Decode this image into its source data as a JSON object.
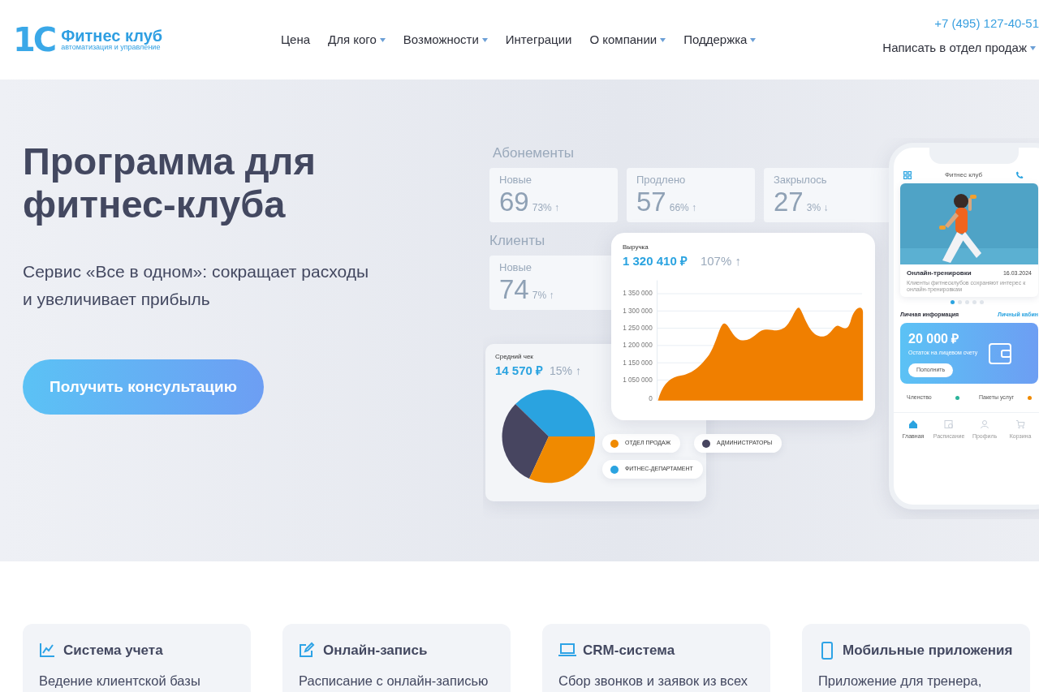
{
  "header": {
    "logo": {
      "mark": "1С",
      "name": "Фитнес клуб",
      "tagline": "автоматизация и управление"
    },
    "nav": [
      {
        "label": "Цена",
        "has_dropdown": false
      },
      {
        "label": "Для кого",
        "has_dropdown": true
      },
      {
        "label": "Возможности",
        "has_dropdown": true
      },
      {
        "label": "Интеграции",
        "has_dropdown": false
      },
      {
        "label": "О компании",
        "has_dropdown": true
      },
      {
        "label": "Поддержка",
        "has_dropdown": true
      }
    ],
    "phone": "+7 (495) 127-40-51",
    "contact": {
      "label": "Написать в отдел продаж",
      "has_dropdown": true
    }
  },
  "hero": {
    "title": "Программа для фитнес-клуба",
    "subtitle": "Сервис «Все в одном»: сокращает расходы и увеличивает прибыль",
    "cta": "Получить консультацию"
  },
  "illustration": {
    "subscriptions": {
      "title": "Абонементы",
      "stats": [
        {
          "label": "Новые",
          "value": "69",
          "change": "73% ↑"
        },
        {
          "label": "Продлено",
          "value": "57",
          "change": "66% ↑"
        },
        {
          "label": "Закрылось",
          "value": "27",
          "change": "3% ↓"
        }
      ]
    },
    "clients": {
      "title": "Клиенты",
      "stats": [
        {
          "label": "Новые",
          "value": "74",
          "change": "7% ↑"
        }
      ]
    },
    "revenue": {
      "title": "Выручка",
      "amount": "1 320 410 ₽",
      "change": "107% ↑",
      "axis_labels": [
        "1 350 000",
        "1 300 000",
        "1 250 000",
        "1 200 000",
        "1 150 000",
        "1 050 000",
        "0"
      ]
    },
    "average_check": {
      "title": "Средний чек",
      "amount": "14 570 ₽",
      "change": "15% ↑",
      "legend": [
        {
          "label": "ОТДЕЛ ПРОДАЖ",
          "color": "#f08a00"
        },
        {
          "label": "АДМИНИСТРАТОРЫ",
          "color": "#474560"
        },
        {
          "label": "ФИТНЕС-ДЕПАРТАМЕНТ",
          "color": "#2aa3e0"
        }
      ]
    },
    "phone": {
      "title": "Фитнес клуб",
      "news": {
        "title": "Онлайн-тренировки",
        "date": "16.03.2024",
        "text": "Клиенты фитнесклубов сохраняют интерес к онлайн-тренировкам"
      },
      "dots": [
        {
          "selected": true
        },
        {
          "selected": false
        },
        {
          "selected": false
        },
        {
          "selected": false
        },
        {
          "selected": false
        }
      ],
      "personal_title": "Личная информация",
      "account_link": "Личный кабин",
      "balance": "20 000 ₽",
      "balance_caption": "Остаток на лицевом счету",
      "top_up": "Пополнить",
      "tiles": [
        {
          "label": "Членство",
          "color": "#2bb39a"
        },
        {
          "label": "Пакеты услуг",
          "color": "#f08a00"
        }
      ],
      "tabbar": [
        {
          "label": "Главная",
          "kind": "home",
          "selected": true
        },
        {
          "label": "Расписание",
          "kind": "calendar",
          "selected": false
        },
        {
          "label": "Профиль",
          "kind": "person",
          "selected": false
        },
        {
          "label": "Корзина",
          "kind": "cart",
          "selected": false
        }
      ]
    }
  },
  "features": [
    {
      "kind": "chart",
      "title": "Система учета",
      "text": "Ведение клиентской базы"
    },
    {
      "kind": "edit",
      "title": "Онлайн-запись",
      "text": "Расписание с онлайн-записью"
    },
    {
      "kind": "laptop",
      "title": "CRM-система",
      "text": "Сбор звонков и заявок из всех"
    },
    {
      "kind": "mobile",
      "title": "Мобильные приложения",
      "text": "Приложение для тренера,"
    }
  ]
}
